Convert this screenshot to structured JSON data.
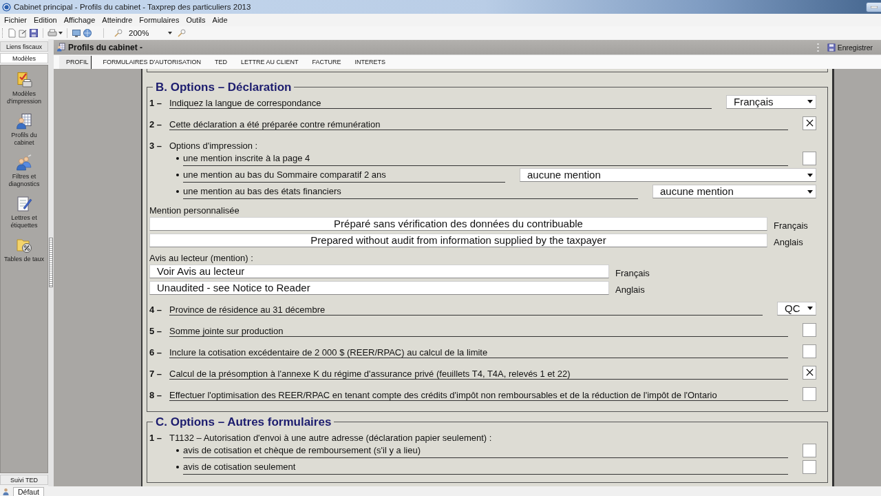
{
  "window": {
    "title": "Cabinet principal - Profils du cabinet - Taxprep des particuliers 2013"
  },
  "menu": [
    "Fichier",
    "Edition",
    "Affichage",
    "Atteindre",
    "Formulaires",
    "Outils",
    "Aide"
  ],
  "toolbar": {
    "zoom": "200%"
  },
  "sidebar": {
    "tabs": [
      {
        "label": "Liens fiscaux",
        "selected": false
      },
      {
        "label": "Modèles",
        "selected": true
      }
    ],
    "items": [
      {
        "label": "Modèles d'impression"
      },
      {
        "label": "Profils du cabinet"
      },
      {
        "label": "Filtres et diagnostics"
      },
      {
        "label": "Lettres et étiquettes"
      },
      {
        "label": "Tables de taux"
      }
    ],
    "footer": "Suivi TED"
  },
  "panel": {
    "title": "Profils du cabinet -",
    "save_button": "Enregistrer",
    "tabs": [
      {
        "label": "PROFIL",
        "selected": true
      },
      {
        "label": "FORMULAIRES D'AUTORISATION",
        "selected": false
      },
      {
        "label": "TED",
        "selected": false
      },
      {
        "label": "LETTRE AU CLIENT",
        "selected": false
      },
      {
        "label": "FACTURE",
        "selected": false
      },
      {
        "label": "INTERETS",
        "selected": false
      }
    ]
  },
  "form": {
    "sections": [
      {
        "title": "B. Options – Déclaration",
        "items": [
          {
            "kind": "select",
            "number": "1 –",
            "label": "Indiquez la langue de correspondance",
            "value": "Français"
          },
          {
            "kind": "checkbox",
            "number": "2 –",
            "label": "Cette déclaration a été préparée contre rémunération",
            "checked": true
          },
          {
            "kind": "group",
            "number": "3 –",
            "label": "Options d'impression :",
            "children": [
              {
                "kind": "checkbox",
                "label": "une mention inscrite à la page 4",
                "checked": false
              },
              {
                "kind": "select",
                "label": "une mention au bas du Sommaire comparatif 2 ans",
                "value": "aucune mention"
              },
              {
                "kind": "select",
                "label": "une mention au bas des états financiers",
                "value": "aucune mention"
              }
            ]
          },
          {
            "kind": "text_fields",
            "label": "Mention personnalisée",
            "fields": [
              {
                "value": "Préparé sans vérification des données du contribuable",
                "language": "Français"
              },
              {
                "value": "Prepared without audit from information supplied by the taxpayer",
                "language": "Anglais"
              }
            ]
          },
          {
            "kind": "text_fields",
            "label": "Avis au lecteur (mention) :",
            "fields": [
              {
                "value": "Voir Avis au lecteur",
                "language": "Français"
              },
              {
                "value": "Unaudited - see Notice to Reader",
                "language": "Anglais"
              }
            ]
          },
          {
            "kind": "select",
            "number": "4 –",
            "label": "Province de résidence au 31 décembre",
            "value": "QC"
          },
          {
            "kind": "checkbox",
            "number": "5 –",
            "label": "Somme jointe sur production",
            "checked": false
          },
          {
            "kind": "checkbox",
            "number": "6 –",
            "label": "Inclure la cotisation excédentaire de 2 000 $ (REER/RPAC) au calcul de la limite",
            "checked": false
          },
          {
            "kind": "checkbox",
            "number": "7 –",
            "label": "Calcul de la présomption à l'annexe K du régime d'assurance privé (feuillets T4, T4A, relevés 1 et 22)",
            "checked": true
          },
          {
            "kind": "checkbox",
            "number": "8 –",
            "label": "Effectuer l'optimisation des REER/RPAC en tenant compte des crédits d'impôt non remboursables et de la réduction de l'impôt de l'Ontario",
            "checked": false
          }
        ]
      },
      {
        "title": "C. Options – Autres formulaires",
        "items": [
          {
            "kind": "group",
            "number": "1 –",
            "label": "T1132 – Autorisation d'envoi à une autre adresse (déclaration papier seulement) :",
            "children": [
              {
                "kind": "checkbox",
                "label": "avis de cotisation et chèque de remboursement (s'il y a lieu)",
                "checked": false
              },
              {
                "kind": "checkbox",
                "label": "avis de cotisation seulement",
                "checked": false
              }
            ]
          }
        ]
      }
    ]
  },
  "status_bar": {
    "tabs": [
      {
        "label": "Défaut",
        "selected": true
      }
    ]
  }
}
